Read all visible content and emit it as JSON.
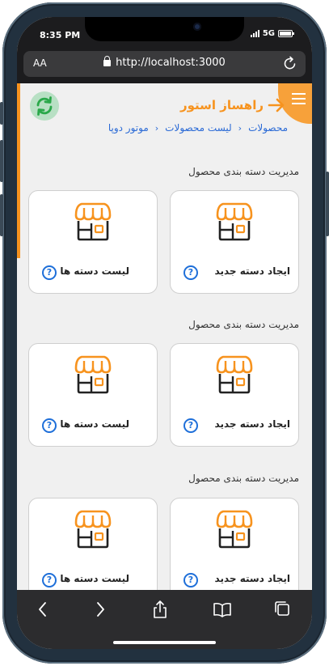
{
  "status_bar": {
    "time": "8:35 PM",
    "network": "5G"
  },
  "browser": {
    "text_size_label": "AA",
    "url": "http://localhost:3000"
  },
  "header": {
    "brand": "راهساز استور",
    "breadcrumbs": [
      "محصولات",
      "لیست محصولات",
      "موتور دوپا"
    ]
  },
  "sections": [
    {
      "title": "مدیریت دسته بندی محصول",
      "cards": [
        {
          "label": "ایجاد دسته جدید",
          "icon": "shop-icon"
        },
        {
          "label": "لیست دسته ها",
          "icon": "shop-icon"
        }
      ]
    },
    {
      "title": "مدیریت دسته بندی محصول",
      "cards": [
        {
          "label": "ایجاد دسته جدید",
          "icon": "shop-icon"
        },
        {
          "label": "لیست دسته ها",
          "icon": "shop-icon"
        }
      ]
    },
    {
      "title": "مدیریت دسته بندی محصول",
      "cards": [
        {
          "label": "ایجاد دسته جدید",
          "icon": "shop-icon"
        },
        {
          "label": "لیست دسته ها",
          "icon": "shop-icon"
        }
      ]
    }
  ],
  "help_glyph": "?",
  "colors": {
    "accent": "#f7931e",
    "link": "#2a6ad6",
    "help": "#1e6fd9",
    "sync_bg": "#b8e0c4",
    "sync_icon": "#2aa84a"
  }
}
